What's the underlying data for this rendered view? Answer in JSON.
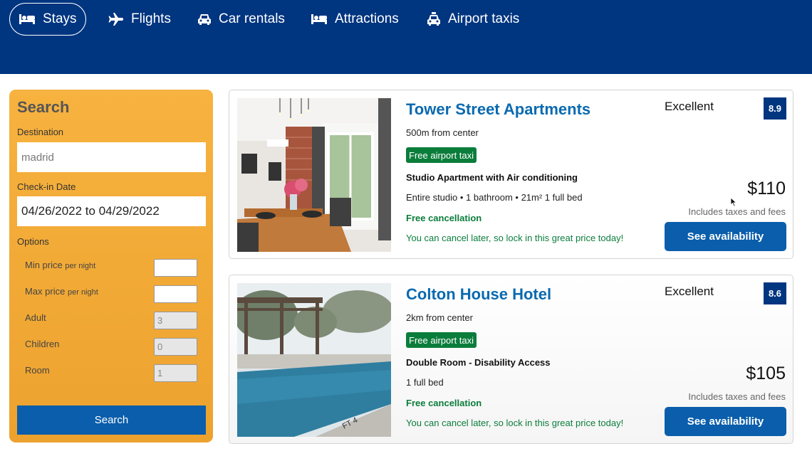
{
  "nav": {
    "items": [
      {
        "label": "Stays",
        "icon": "bed-icon",
        "active": true
      },
      {
        "label": "Flights",
        "icon": "plane-icon",
        "active": false
      },
      {
        "label": "Car rentals",
        "icon": "car-icon",
        "active": false
      },
      {
        "label": "Attractions",
        "icon": "bed-icon",
        "active": false
      },
      {
        "label": "Airport taxis",
        "icon": "taxi-icon",
        "active": false
      }
    ]
  },
  "search": {
    "title": "Search",
    "destination_label": "Destination",
    "destination_value": "madrid",
    "checkin_label": "Check-in Date",
    "checkin_value": "04/26/2022 to 04/29/2022",
    "options_label": "Options",
    "min_price_label": "Min price",
    "max_price_label": "Max price",
    "per_night": "per night",
    "adult_label": "Adult",
    "adult_value": "3",
    "children_label": "Children",
    "children_value": "0",
    "room_label": "Room",
    "room_value": "1",
    "button_label": "Search"
  },
  "results": [
    {
      "name": "Tower Street Apartments",
      "distance": "500m from center",
      "taxi_badge": "Free airport taxi",
      "room_type": "Studio Apartment with Air conditioning",
      "features": "Entire studio • 1 bathroom • 21m² 1 full bed",
      "cancellation": "Free cancellation",
      "cancellation_sub": "You can cancel later, so lock in this great price today!",
      "rating_text": "Excellent",
      "rating": "8.9",
      "price": "$110",
      "taxes_note": "Includes taxes and fees",
      "button_label": "See availability"
    },
    {
      "name": "Colton House Hotel",
      "distance": "2km from center",
      "taxi_badge": "Free airport taxi",
      "room_type": "Double Room - Disability Access",
      "features": "1 full bed",
      "cancellation": "Free cancellation",
      "cancellation_sub": "You can cancel later, so lock in this great price today!",
      "rating_text": "Excellent",
      "rating": "8.6",
      "price": "$105",
      "taxes_note": "Includes taxes and fees",
      "button_label": "See availability"
    }
  ],
  "colors": {
    "header_bg": "#003580",
    "search_panel_bg": "#f6ad3a",
    "button_blue": "#0a5eab",
    "hotel_name": "#0a6ab0",
    "green": "#0b7d3b"
  }
}
